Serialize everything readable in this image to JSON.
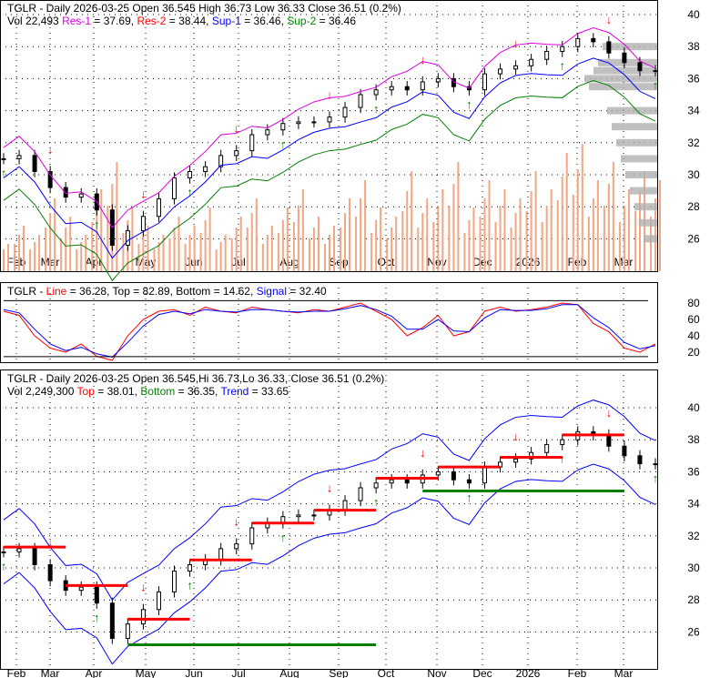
{
  "panels": {
    "price": {
      "line1": "TGLR - Daily 2026-03-25 Open 36.545  High 36.73  Low 36.33  Close 36.51 (0.2%)",
      "vol": "Vol 22,493",
      "res1": "Res-1",
      "res1_val": " = 37.69, ",
      "res2": "Res-2",
      "res2_val": " = 38.44, ",
      "sup1": "Sup-1",
      "sup1_val": " = 36.46, ",
      "sup2": "Sup-2",
      "sup2_val": " = 36.46"
    },
    "osc": {
      "prefix": "TGLR - ",
      "line": "Line",
      "line_val": " = 36.28, Top = 82.89, Bottom = 14.62, ",
      "signal": "Signal",
      "signal_val": " = 32.40"
    },
    "trend": {
      "line1": "TGLR - Daily 2026-03-25 Open 36.545,Hi 36.73,Lo 36.33, Close 36.51 (0.2%)",
      "vol": "Vol 2,249,300 ",
      "top": "Top",
      "top_val": " = 38.01, ",
      "bottom": "Bottom",
      "bottom_val": " = 36.35, ",
      "trend": "Trend",
      "trend_val": " = 33.65"
    }
  },
  "colors": {
    "up": "#008000",
    "down": "#ff0000",
    "band": "#0000ff",
    "volume": "#f4a582",
    "profile": "#b0b0b0"
  },
  "chart_data": {
    "type": "line",
    "title": "TGLR - Daily",
    "x_labels": [
      "Feb",
      "Mar",
      "Apr",
      "May",
      "Jun",
      "Jul",
      "Aug",
      "Sep",
      "Oct",
      "Nov",
      "Dec",
      "2026",
      "Feb",
      "Mar"
    ],
    "price_ylim": [
      24.5,
      40.8
    ],
    "price_ticks": [
      26,
      28,
      30,
      32,
      34,
      36,
      38,
      40
    ],
    "osc_ticks": [
      20,
      40,
      60,
      80
    ],
    "close": [
      31,
      31.2,
      30.2,
      29.2,
      28.6,
      28.8,
      27.8,
      25.6,
      26.5,
      27.4,
      28.5,
      29.8,
      30.2,
      30.5,
      31.2,
      31.5,
      32.5,
      32.8,
      33.2,
      33.3,
      33.3,
      33.6,
      34.2,
      35,
      35.3,
      35.5,
      35.3,
      35.8,
      36,
      35.5,
      35.3,
      36.3,
      36.6,
      36.8,
      37.2,
      37.7,
      38,
      38.5,
      38.3,
      37.6,
      37,
      36.5,
      36.5
    ],
    "volume": [
      3,
      5,
      4,
      8,
      6,
      4,
      9,
      12,
      7,
      5,
      4,
      6,
      5,
      7,
      4,
      6,
      8,
      5,
      7,
      9,
      6,
      5,
      8,
      10,
      7,
      6,
      11,
      8,
      9,
      12,
      7,
      10,
      9,
      8,
      11,
      9,
      13,
      14,
      10,
      12,
      9,
      11,
      10
    ],
    "osc_line": [
      70,
      65,
      40,
      25,
      20,
      30,
      15,
      10,
      40,
      60,
      70,
      72,
      65,
      75,
      70,
      68,
      75,
      72,
      70,
      68,
      72,
      70,
      75,
      80,
      70,
      60,
      40,
      50,
      65,
      40,
      45,
      70,
      75,
      70,
      72,
      75,
      80,
      78,
      55,
      45,
      25,
      20,
      30
    ],
    "osc_signal": [
      72,
      68,
      48,
      30,
      22,
      26,
      18,
      14,
      32,
      52,
      66,
      70,
      67,
      72,
      70,
      69,
      72,
      72,
      70,
      69,
      70,
      70,
      73,
      77,
      72,
      64,
      48,
      48,
      60,
      46,
      45,
      62,
      72,
      71,
      71,
      73,
      78,
      78,
      62,
      50,
      32,
      24,
      28
    ]
  }
}
